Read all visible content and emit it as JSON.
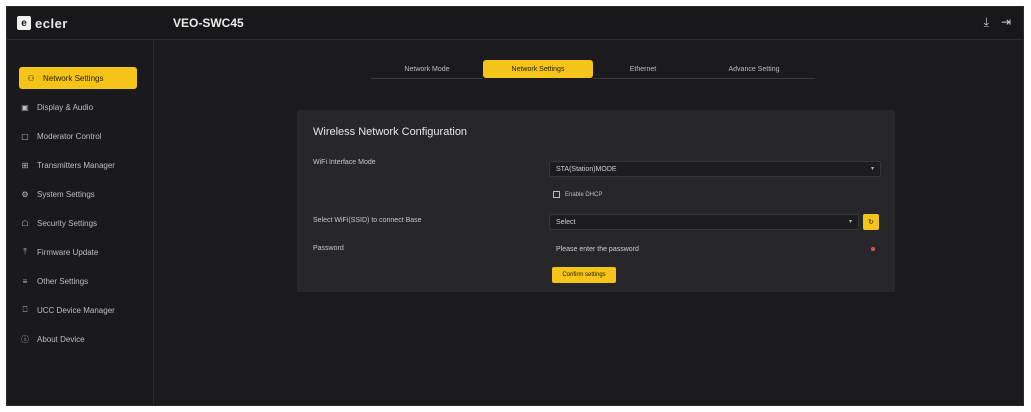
{
  "header": {
    "logo_mark": "e",
    "logo_text": "ecler",
    "device_title": "VEO-SWC45",
    "icons": [
      "download-icon",
      "logout-icon"
    ]
  },
  "sidebar": {
    "items": [
      {
        "label": "Network Settings",
        "icon": "network-icon",
        "active": true
      },
      {
        "label": "Display & Audio",
        "icon": "display-icon",
        "active": false
      },
      {
        "label": "Moderator Control",
        "icon": "moderator-icon",
        "active": false
      },
      {
        "label": "Transmitters Manager",
        "icon": "transmitter-icon",
        "active": false
      },
      {
        "label": "System Settings",
        "icon": "gear-icon",
        "active": false
      },
      {
        "label": "Security Settings",
        "icon": "lock-icon",
        "active": false
      },
      {
        "label": "Firmware Update",
        "icon": "upload-icon",
        "active": false
      },
      {
        "label": "Other Settings",
        "icon": "sliders-icon",
        "active": false
      },
      {
        "label": "UCC Device Manager",
        "icon": "device-icon",
        "active": false
      },
      {
        "label": "About Device",
        "icon": "info-icon",
        "active": false
      }
    ]
  },
  "tabs": [
    {
      "label": "Network Mode",
      "active": false
    },
    {
      "label": "Network Settings",
      "active": true
    },
    {
      "label": "Ethernet",
      "active": false
    },
    {
      "label": "Advance Setting",
      "active": false
    }
  ],
  "panel": {
    "title": "Wireless Network Configuration",
    "wifi_mode_label": "WiFi Interface Mode",
    "wifi_mode_value": "STA(Station)MODE",
    "dhcp_label": "Enable DHCP",
    "ssid_label": "Select WiFi(SSID) to connect Base",
    "ssid_value": "Select",
    "password_label": "Password",
    "password_placeholder": "Please enter the password",
    "confirm_label": "Confirm settings"
  },
  "colors": {
    "accent": "#f5c418",
    "background": "#1b1b1e",
    "panel": "#27272b",
    "required": "#e84a4a"
  }
}
